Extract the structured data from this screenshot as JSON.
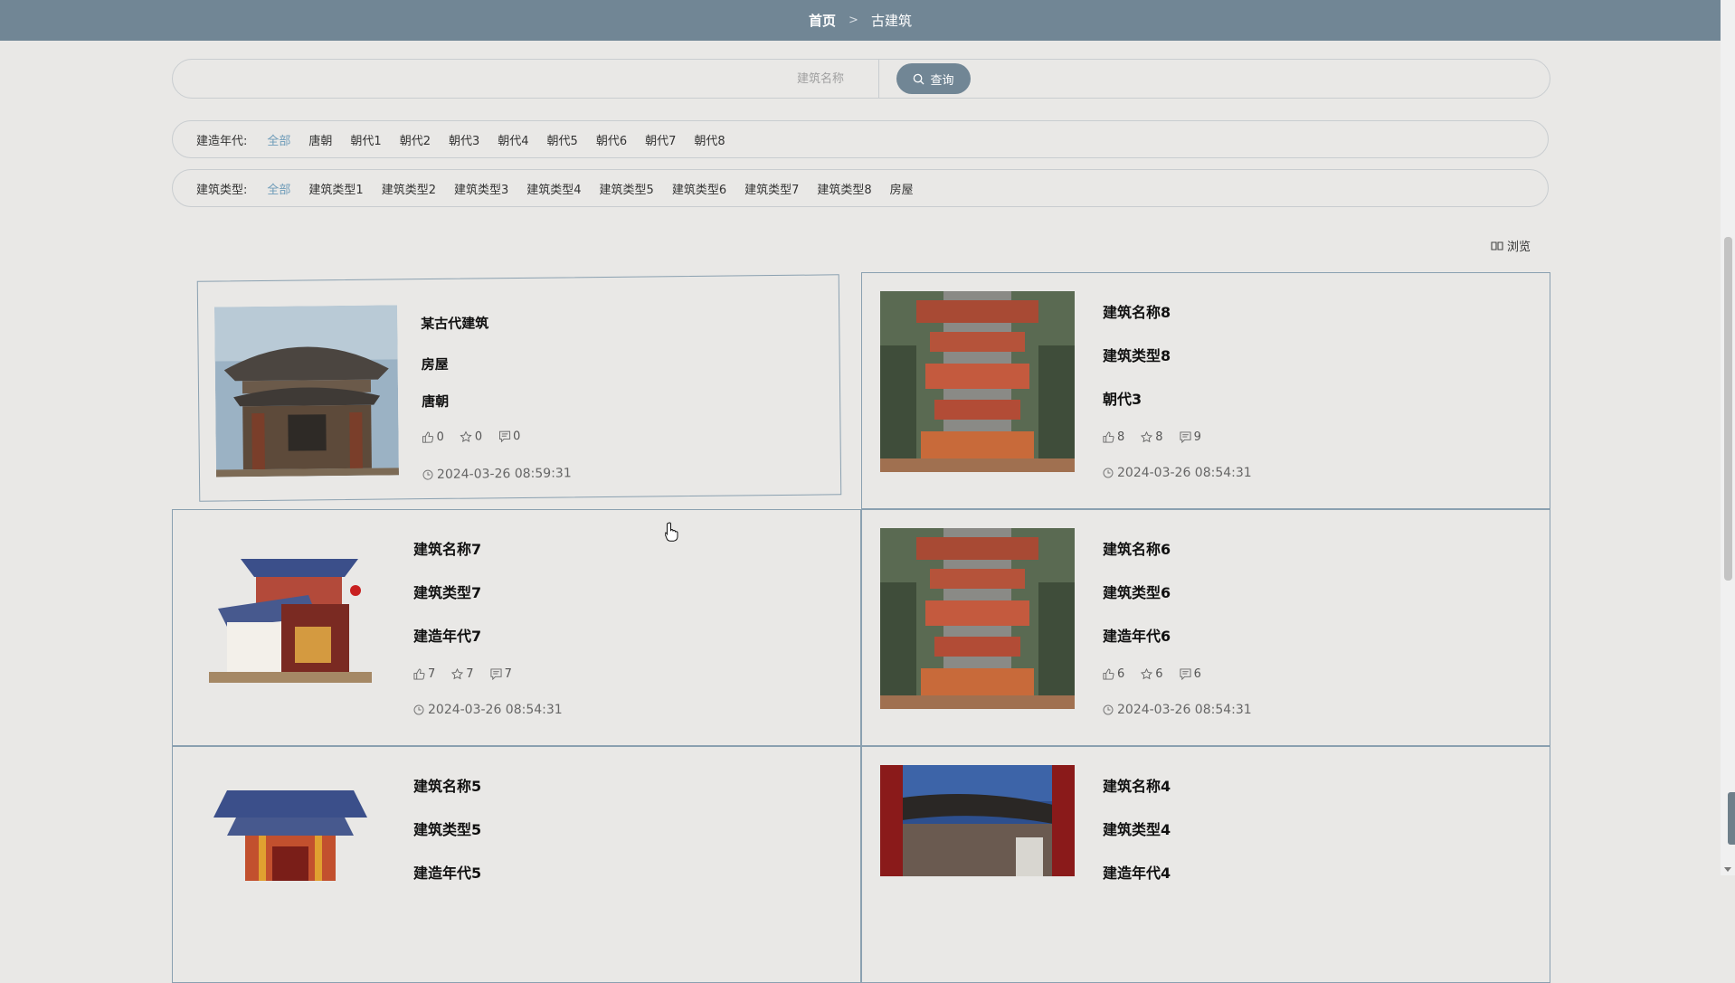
{
  "breadcrumb": {
    "home": "首页",
    "separator": ">",
    "current": "古建筑"
  },
  "search": {
    "placeholder": "建筑名称",
    "button_label": "查询"
  },
  "filters": {
    "era": {
      "label": "建造年代:",
      "options": [
        "全部",
        "唐朝",
        "朝代1",
        "朝代2",
        "朝代3",
        "朝代4",
        "朝代5",
        "朝代6",
        "朝代7",
        "朝代8"
      ],
      "active_index": 0
    },
    "type": {
      "label": "建筑类型:",
      "options": [
        "全部",
        "建筑类型1",
        "建筑类型2",
        "建筑类型3",
        "建筑类型4",
        "建筑类型5",
        "建筑类型6",
        "建筑类型7",
        "建筑类型8",
        "房屋"
      ],
      "active_index": 0
    }
  },
  "browse_label": "浏览",
  "cards": [
    {
      "name": "某古代建筑",
      "type": "房屋",
      "era": "唐朝",
      "likes": "0",
      "favorites": "0",
      "comments": "0",
      "time": "2024-03-26 08:59:31",
      "image": "pavilion"
    },
    {
      "name": "建筑名称8",
      "type": "建筑类型8",
      "era": "朝代3",
      "likes": "8",
      "favorites": "8",
      "comments": "9",
      "time": "2024-03-26 08:54:31",
      "image": "palace-aerial"
    },
    {
      "name": "建筑名称7",
      "type": "建筑类型7",
      "era": "建造年代7",
      "likes": "7",
      "favorites": "7",
      "comments": "7",
      "time": "2024-03-26 08:54:31",
      "image": "model-house"
    },
    {
      "name": "建筑名称6",
      "type": "建筑类型6",
      "era": "建造年代6",
      "likes": "6",
      "favorites": "6",
      "comments": "6",
      "time": "2024-03-26 08:54:31",
      "image": "palace-aerial"
    },
    {
      "name": "建筑名称5",
      "type": "建筑类型5",
      "era": "建造年代5",
      "image": "model-gate"
    },
    {
      "name": "建筑名称4",
      "type": "建筑类型4",
      "era": "建造年代4",
      "image": "courtyard"
    }
  ],
  "colors": {
    "accent": "#718695",
    "active_filter": "#6d9bb8",
    "card_border": "#8aa0b0"
  }
}
